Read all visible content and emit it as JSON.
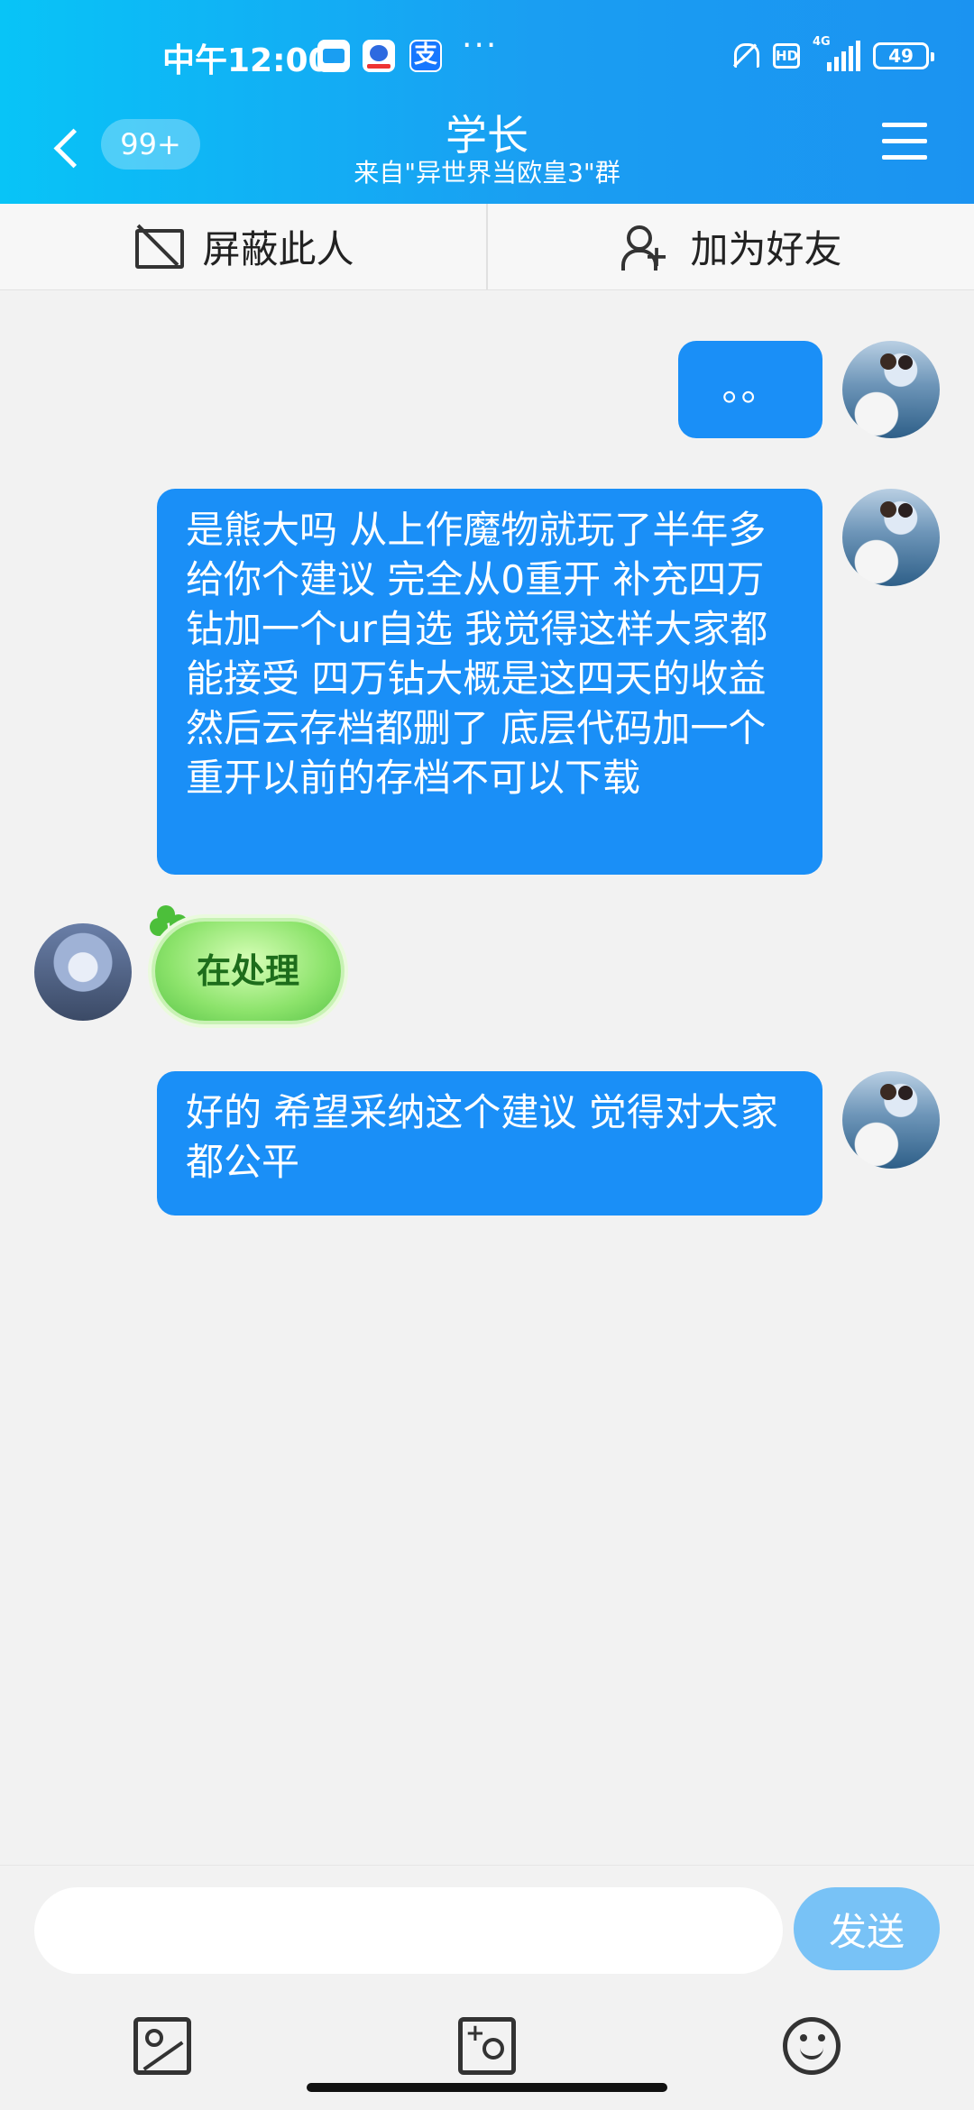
{
  "status_bar": {
    "time": "中午12:00",
    "more": "···",
    "network": "4G",
    "battery": "49",
    "icons": [
      "message-app-icon",
      "baidu-app-icon",
      "alipay-app-icon",
      "mute-bell-icon",
      "hd-icon",
      "signal-icon",
      "battery-icon"
    ],
    "alipay_glyph": "支",
    "hd_label": "HD"
  },
  "header": {
    "unread_badge": "99+",
    "title": "学长",
    "subtitle": "来自\"异世界当欧皇3\"群",
    "colors": {
      "gradient_start": "#08c4f7",
      "gradient_end": "#1b93f1"
    }
  },
  "actions": {
    "block": "屏蔽此人",
    "add_friend": "加为好友"
  },
  "messages": [
    {
      "sender": "self",
      "type": "text",
      "text": "。。"
    },
    {
      "sender": "self",
      "type": "text",
      "text": "是熊大吗  从上作魔物就玩了半年多 给你个建议   完全从0重开   补充四万钻加一个ur自选   我觉得这样大家都能接受   四万钻大概是这四天的收益   然后云存档都删了    底层代码加一个重开以前的存档不可以下载"
    },
    {
      "sender": "other",
      "type": "sticker",
      "text": "在处理"
    },
    {
      "sender": "self",
      "type": "text",
      "text": "好的  希望采纳这个建议    觉得对大家都公平"
    }
  ],
  "input": {
    "placeholder": "",
    "value": "",
    "send_label": "发送"
  },
  "colors": {
    "bubble_self": "#1a8ff7",
    "send_button": "#78c2f6",
    "background": "#f2f2f2"
  }
}
